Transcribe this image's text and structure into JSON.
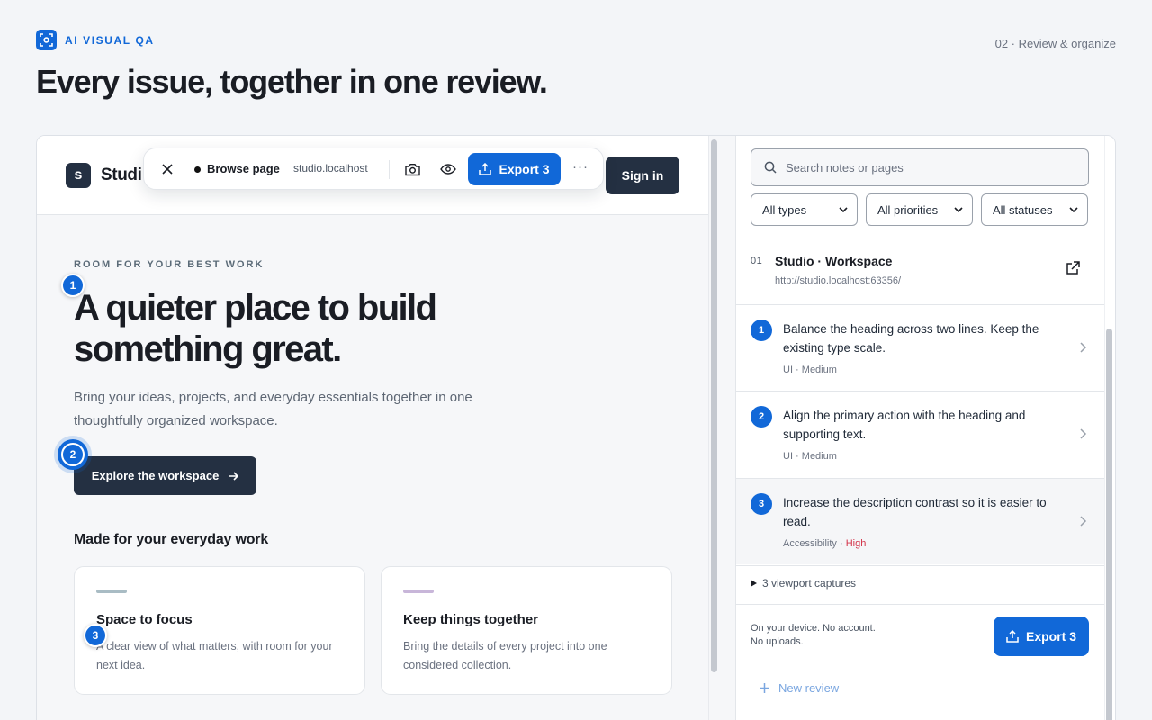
{
  "brand": {
    "label": "AI VISUAL QA",
    "color": "#1168d8"
  },
  "step": "02 · Review & organize",
  "headline": "Every issue, together in one review.",
  "site": {
    "logo_letter": "s",
    "name": "Studi",
    "sign_in": "Sign in",
    "eyebrow": "ROOM FOR YOUR BEST WORK",
    "hero_title": "A quieter place to build something great.",
    "hero_desc": "Bring your ideas, projects, and everyday essentials together in one thoughtfully organized workspace.",
    "cta": "Explore the workspace",
    "section_title": "Made for your everyday work",
    "cards": [
      {
        "title": "Space to focus",
        "text": "A clear view of what matters, with room for your next idea.",
        "accent": "#a9bcc4"
      },
      {
        "title": "Keep things together",
        "text": "Bring the details of every project into one considered collection.",
        "accent": "#c8b6d9"
      }
    ]
  },
  "toolbar": {
    "mode": "Browse page",
    "host": "studio.localhost",
    "export": "Export 3",
    "more": "···"
  },
  "markers": [
    "1",
    "2",
    "3"
  ],
  "panel": {
    "search_placeholder": "Search notes or pages",
    "filters": [
      "All types",
      "All priorities",
      "All statuses"
    ],
    "page": {
      "number": "01",
      "title": "Studio · Workspace",
      "url": "http://studio.localhost:63356/"
    },
    "notes": [
      {
        "num": "1",
        "text": "Balance the heading across two lines. Keep the existing type scale.",
        "type": "UI",
        "priority": "Medium"
      },
      {
        "num": "2",
        "text": "Align the primary action with the heading and supporting text.",
        "type": "UI",
        "priority": "Medium"
      },
      {
        "num": "3",
        "text": "Increase the description contrast so it is easier to read.",
        "type": "Accessibility",
        "priority": "High"
      }
    ],
    "captures": "3 viewport captures",
    "footnote": "On your device. No account. No uploads.",
    "export": "Export 3",
    "new_review": "New review"
  }
}
